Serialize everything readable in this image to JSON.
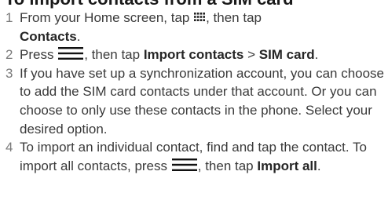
{
  "heading": "To import contacts from a SIM card",
  "steps": [
    {
      "number": "1",
      "text_before": "From your Home screen, tap",
      "icon": "apps-grid-icon",
      "text_after": ", then tap",
      "bold": "Contacts",
      "end": "."
    },
    {
      "number": "2",
      "text_before": "Press",
      "icon": "menu-icon",
      "text_after": ", then tap",
      "bold_1": "Import contacts",
      "separator": " > ",
      "bold_2": "SIM card",
      "end": "."
    },
    {
      "number": "3",
      "text": "If you have set up a synchronization account, you can choose to add the SIM card contacts under that account. Or you can choose to only use these contacts in the phone. Select your desired option."
    },
    {
      "number": "4",
      "text_before": "To import an individual contact, find and tap the contact. To import all contacts, press",
      "icon": "menu-icon",
      "text_after": ", then tap",
      "bold": "Import all",
      "end": "."
    }
  ]
}
